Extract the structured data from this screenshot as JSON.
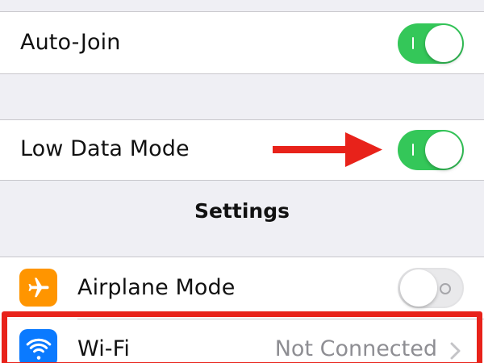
{
  "settings": {
    "auto_join": {
      "label": "Auto-Join",
      "enabled": true
    },
    "low_data_mode": {
      "label": "Low Data Mode",
      "enabled": true
    },
    "section_title": "Settings",
    "airplane_mode": {
      "label": "Airplane Mode",
      "enabled": false,
      "icon": "airplane-icon"
    },
    "wifi": {
      "label": "Wi-Fi",
      "value": "Not Connected",
      "icon": "wifi-icon"
    }
  },
  "annotations": {
    "arrow_icon": "right-arrow-icon",
    "highlight_color": "#e8221a"
  },
  "colors": {
    "toggle_on": "#34c759",
    "airplane_icon_bg": "#ff9500",
    "wifi_icon_bg": "#0a7aff"
  }
}
